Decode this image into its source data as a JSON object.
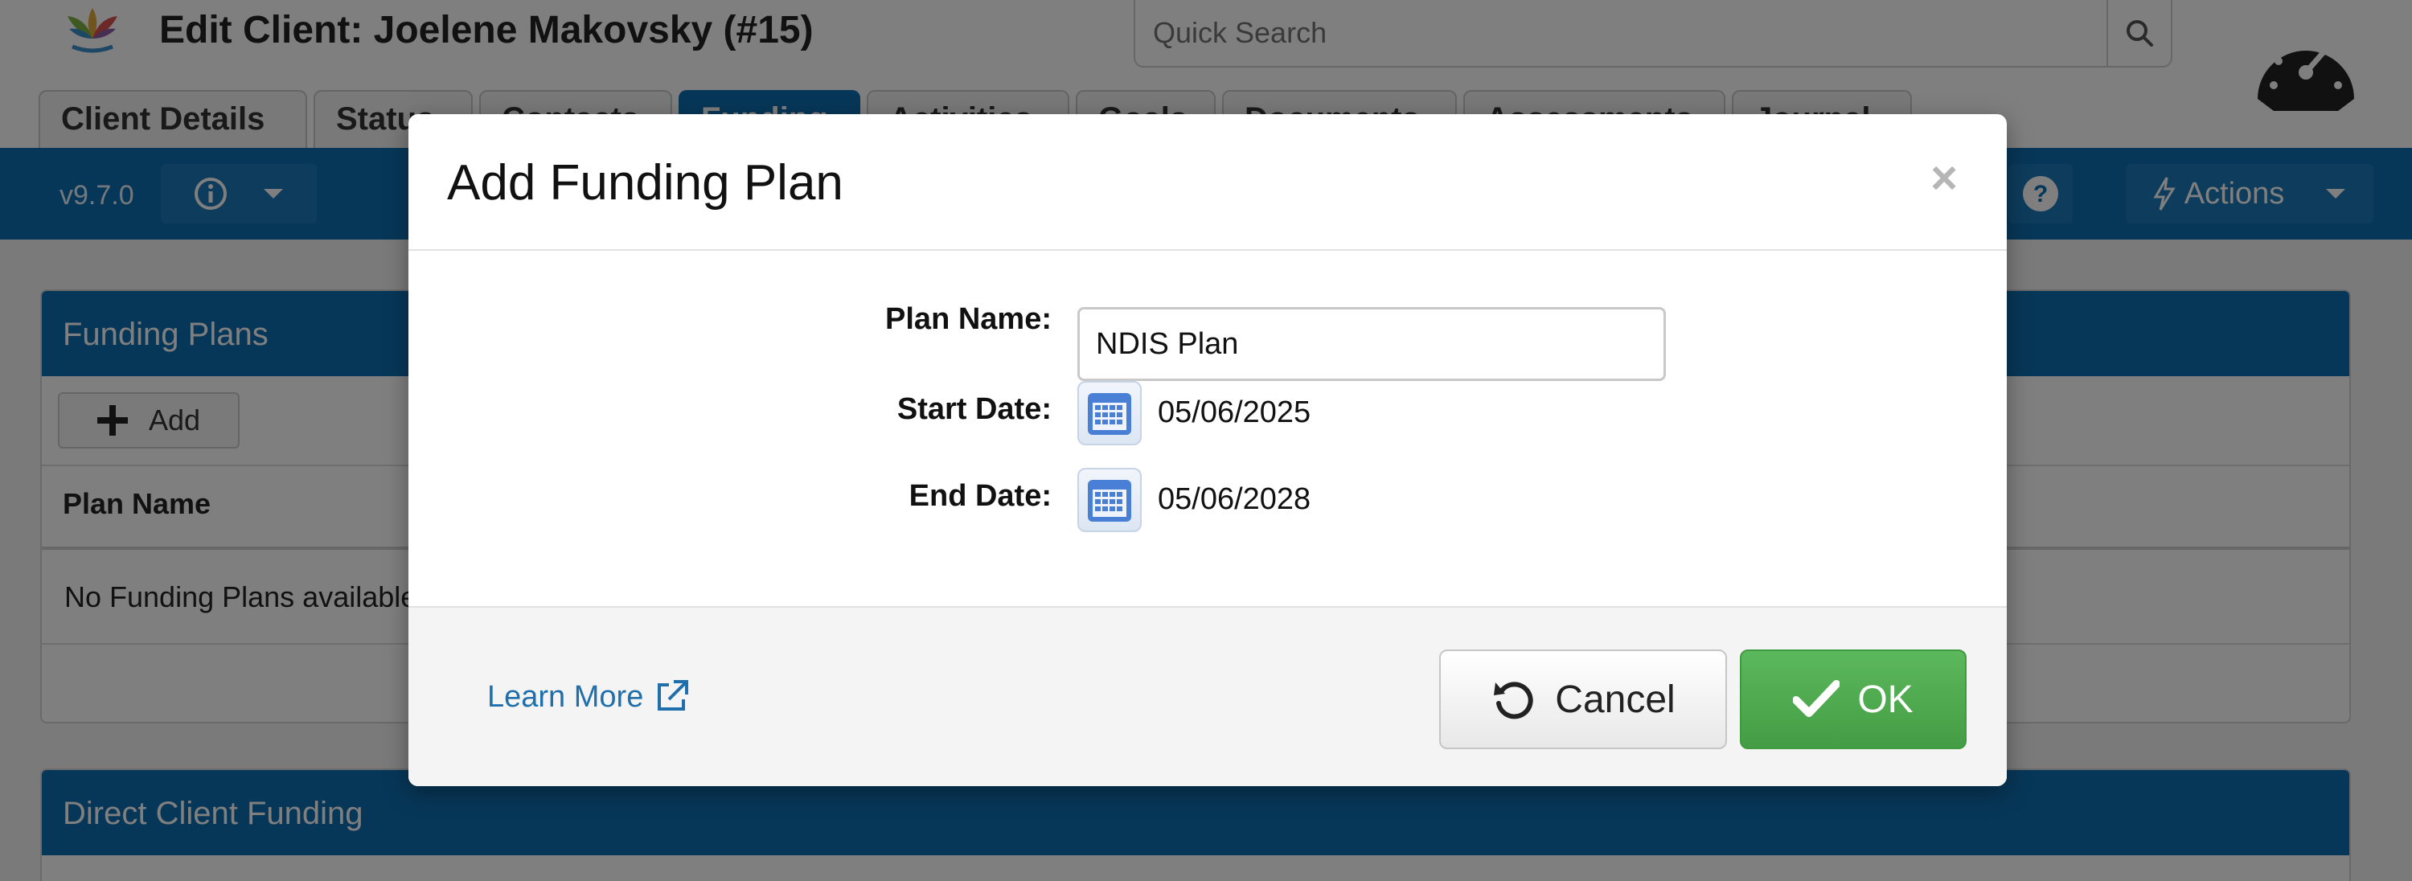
{
  "page": {
    "title": "Edit Client:  Joelene Makovsky (#15)",
    "search_placeholder": "Quick Search",
    "version": "v9.7.0",
    "actions_label": "Actions",
    "tabs": [
      {
        "label": "Client Details",
        "active": false
      },
      {
        "label": "Status",
        "active": false
      },
      {
        "label": "Contacts",
        "active": false
      },
      {
        "label": "Funding",
        "active": true
      },
      {
        "label": "Activities",
        "active": false
      },
      {
        "label": "Goals",
        "active": false
      },
      {
        "label": "Documents",
        "active": false
      },
      {
        "label": "Assessments",
        "active": false
      },
      {
        "label": "Journal",
        "active": false
      }
    ],
    "funding_panel": {
      "title": "Funding Plans",
      "add_label": "Add",
      "column_header": "Plan Name",
      "empty_message": "No Funding Plans available"
    },
    "direct_panel": {
      "title": "Direct Client Funding"
    }
  },
  "modal": {
    "title": "Add Funding Plan",
    "close_symbol": "×",
    "fields": {
      "plan_name_label": "Plan Name:",
      "plan_name_value": "NDIS Plan",
      "start_date_label": "Start Date:",
      "start_date_value": "05/06/2025",
      "end_date_label": "End Date:",
      "end_date_value": "05/06/2028"
    },
    "learn_more": "Learn More",
    "cancel_label": "Cancel",
    "ok_label": "OK"
  },
  "colors": {
    "primary_blue": "#0f6fb0",
    "ok_green": "#5cb85c",
    "link_blue": "#1f6fad"
  }
}
